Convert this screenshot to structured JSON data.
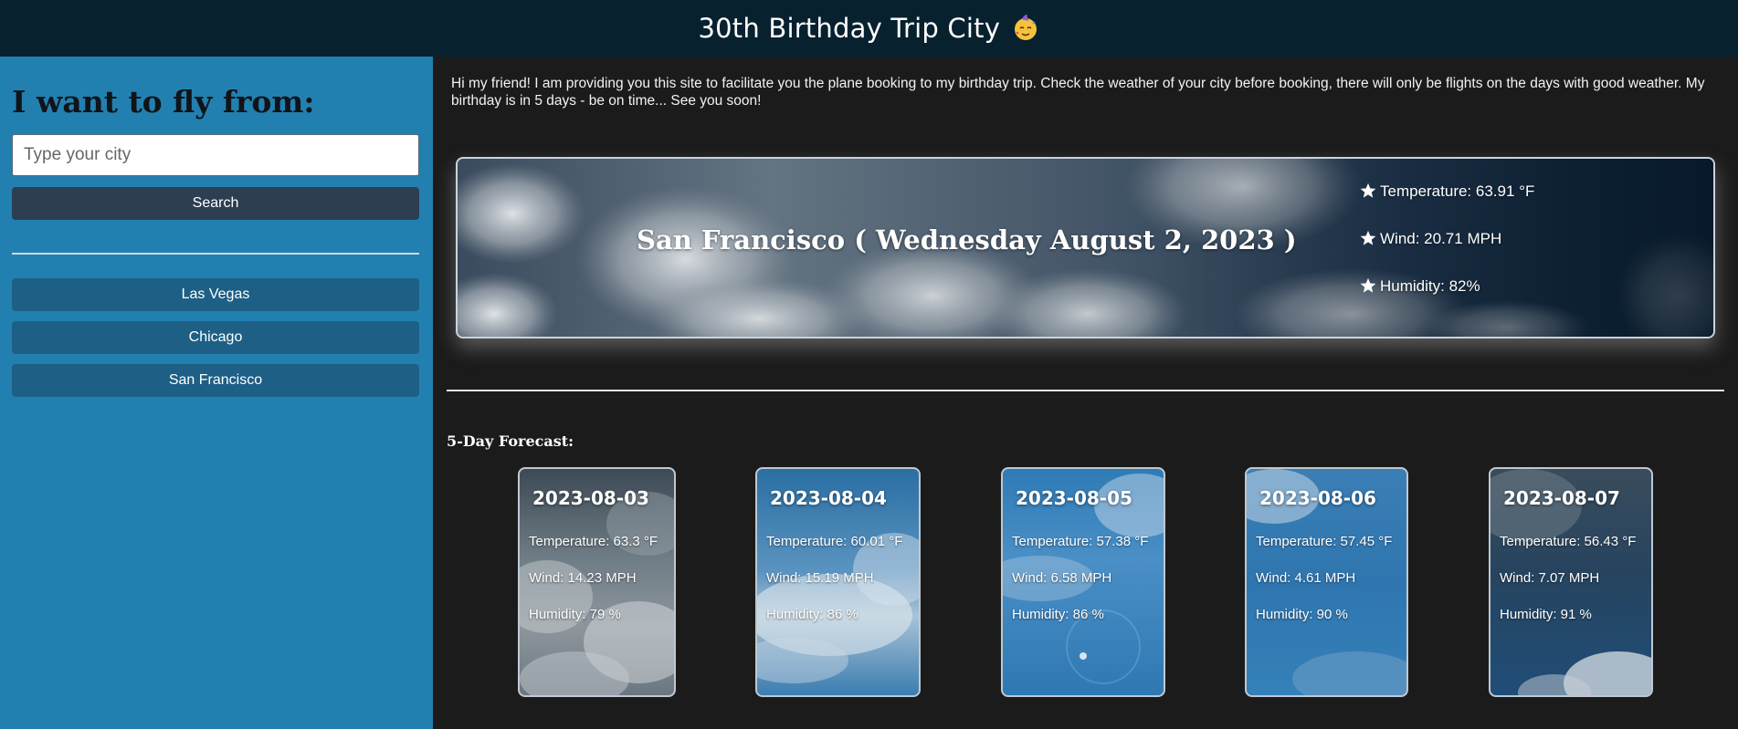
{
  "header": {
    "title": "30th Birthday Trip City",
    "icon": "partying-face-icon"
  },
  "sidebar": {
    "heading": "I want to fly from:",
    "search_placeholder": "Type your city",
    "search_value": "",
    "search_button": "Search",
    "history": [
      "Las Vegas",
      "Chicago",
      "San Francisco"
    ]
  },
  "intro": "Hi my friend! I am providing you this site to facilitate you the plane booking to my birthday trip. Check the weather of your city before booking, there will only be flights on the days with good weather. My birthday is in 5 days - be on time... See you soon!",
  "current": {
    "title": "San Francisco ( Wednesday August 2, 2023 )",
    "temperature": "Temperature: 63.91 °F",
    "wind": "Wind: 20.71 MPH",
    "humidity": "Humidity: 82%"
  },
  "forecast": {
    "heading": "5-Day Forecast:",
    "days": [
      {
        "date": "2023-08-03",
        "temperature": "Temperature: 63.3 °F",
        "wind": "Wind: 14.23 MPH",
        "humidity": "Humidity: 79 %"
      },
      {
        "date": "2023-08-04",
        "temperature": "Temperature: 60.01 °F",
        "wind": "Wind: 15.19 MPH",
        "humidity": "Humidity: 86 %"
      },
      {
        "date": "2023-08-05",
        "temperature": "Temperature: 57.38 °F",
        "wind": "Wind: 6.58 MPH",
        "humidity": "Humidity: 86 %"
      },
      {
        "date": "2023-08-06",
        "temperature": "Temperature: 57.45 °F",
        "wind": "Wind: 4.61 MPH",
        "humidity": "Humidity: 90 %"
      },
      {
        "date": "2023-08-07",
        "temperature": "Temperature: 56.43 °F",
        "wind": "Wind: 7.07 MPH",
        "humidity": "Humidity: 91 %"
      }
    ]
  },
  "colors": {
    "header_bg": "#08212f",
    "sidebar_bg": "#2280b0",
    "page_bg": "#1b1b1b",
    "search_button_bg": "#2d3d52",
    "history_button_bg": "#1d5f85"
  }
}
